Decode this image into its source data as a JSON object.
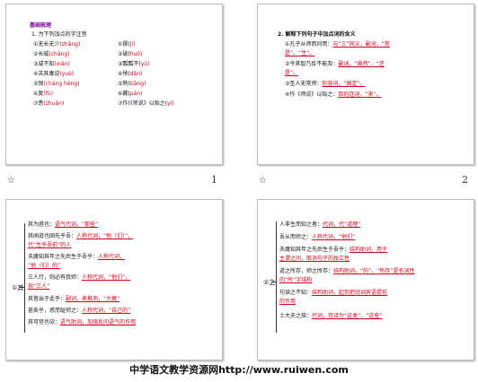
{
  "slides": [
    {
      "number": "1",
      "title": "基础梳理",
      "heading": "1. 为下列加点的字注音",
      "items_left": [
        "①无长无少(zhǎng)",
        "②长城(cháng)",
        "③咸不知(xián)",
        "④苦其毒说(yuè)",
        "⑤恨(chàng hèng)",
        "⑥复(fù)",
        "⑦悉(zhuān)"
      ],
      "items_left_plain": [
        "①无长无少",
        "②长城",
        "③咸不知",
        "④苦其毒说",
        "⑤恨",
        "⑥复",
        "⑦悉"
      ],
      "items_left_pinyin": [
        "(zhǎng)",
        "(cháng)",
        "(xián)",
        "(yuè)",
        "(chàng hèng)",
        "(fù)",
        "(zhuān)"
      ],
      "items_right_plain": [
        "①掷(",
        "②破(",
        "③瓢瓢不(",
        "④殃(",
        "⑤熟(",
        "⑥藏(",
        "⑦作(《师说》以贻之("
      ],
      "items_right_pinyin": [
        "jì)",
        "huō)",
        "yǔ)",
        "dǎn)",
        "tiāng)",
        "pán)",
        "yí)"
      ]
    },
    {
      "number": "2",
      "heading": "2. 解释下列句子中加点词的含义",
      "lines": [
        {
          "label": "①孔子从师而问焉：",
          "answer": "与“三”同义，副词，“常"
        },
        {
          "label": "",
          "answer": "是”、“生”。"
        },
        {
          "label": "②今其智乃反不能及：",
          "answer": "副词，“竟然”、“还"
        },
        {
          "label": "",
          "answer": "是”。"
        },
        {
          "label": "③圣人无常师：",
          "answer": "形容词，“固定”。"
        },
        {
          "label": "④作《师说》以贻之：",
          "answer": "目的连词，“来”。"
        }
      ]
    },
    {
      "number": "",
      "left_char": "①其",
      "lines": [
        {
          "label": "其为惑也：",
          "answer": "语气代词，“那些”"
        },
        {
          "label": "其闻道也固先乎吾：",
          "answer": "人称代词，“他（们）”，"
        },
        {
          "label": "",
          "answer": "代“生乎吾前”的人"
        },
        {
          "label": "夫庸知其年之先后生于吾乎：",
          "answer": "人称代词，"
        },
        {
          "label": "",
          "answer": "“他（们）的”"
        },
        {
          "label": "三人行，则必有我师：",
          "answer": "人称代词，“他们”，"
        },
        {
          "label": "",
          "answer": "指“三人”"
        },
        {
          "label": "其皆出于此乎：",
          "answer": "副词，表推测，“大概”"
        },
        {
          "label": "甚矣乎，惑而耻师之：",
          "answer": "人称代词，“自己的”"
        },
        {
          "label": "其可怪也欤：",
          "answer": "语气助词，加强反问语气的作用"
        }
      ]
    },
    {
      "number": "",
      "left_char": "②之",
      "lines": [
        {
          "label": "人非生而知之者：",
          "answer": "代词，代“道理”"
        },
        {
          "label": "吾从而师之：",
          "answer": "人称代词，“他们”"
        },
        {
          "label": "夫庸知其年之先后生于吾乎：",
          "answer": "结构助词，用于"
        },
        {
          "label": "",
          "answer": "主谓之间，取消句子的独立性"
        },
        {
          "label": "道之所存，师之所存：",
          "answer": "结构助词，“的”、“所存”是名词性"
        },
        {
          "label": "",
          "answer": "的“所”字结构"
        },
        {
          "label": "句读之不知：",
          "answer": "结构助词，起到把动词宾语提前"
        },
        {
          "label": "",
          "answer": "的作用"
        },
        {
          "label": "士大夫之族：",
          "answer": "代词，可译为“这类”、“这些”"
        }
      ]
    }
  ],
  "footer": "中学语文教学资源网http://www.ruiwen.com",
  "colors": {
    "accent_red": "#d8001a",
    "title_purple": "#7a0099"
  }
}
